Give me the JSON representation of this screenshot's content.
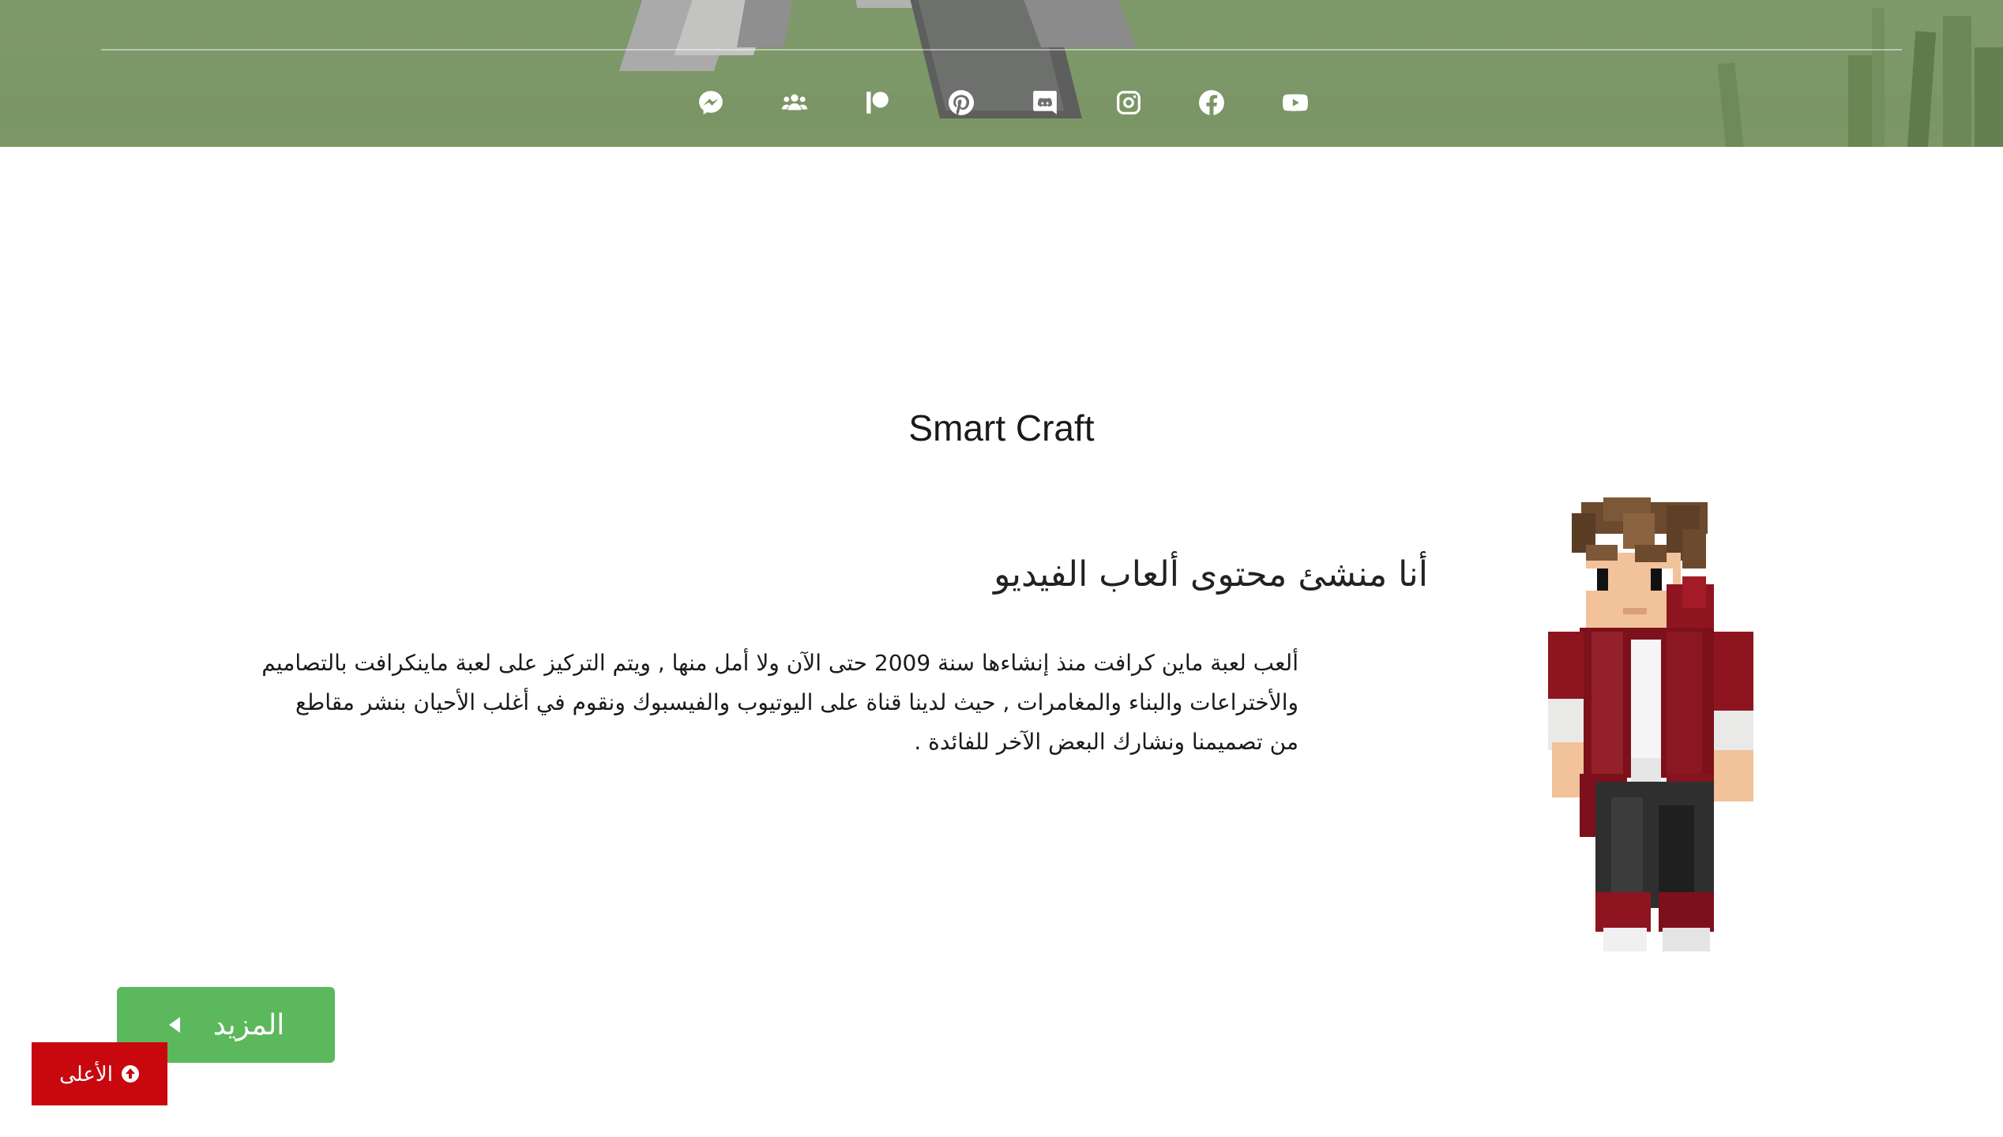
{
  "site": {
    "title": "Smart Craft"
  },
  "social": {
    "icons": [
      "messenger-icon",
      "group-icon",
      "patreon-icon",
      "pinterest-icon",
      "discord-icon",
      "instagram-icon",
      "facebook-icon",
      "youtube-icon"
    ]
  },
  "about": {
    "headline": "أنا منشئ محتوى ألعاب الفيديو",
    "lines": [
      "ألعب لعبة ماين كرافت منذ إنشاءها سنة 2009 حتى الآن ولا أمل منها , ويتم التركيز على لعبة ماينكرافت بالتصاميم",
      "والأختراعات والبناء والمغامرات , حيث لدينا قناة على اليوتيوب والفيسبوك ونقوم في أغلب الأحيان بنشر مقاطع",
      "من تصميمنا ونشارك البعض الآخر للفائدة ."
    ]
  },
  "buttons": {
    "more_label": "المزيد",
    "more_icon": "caret-left-icon",
    "top_label": "الأعلى",
    "top_icon": "arrow-up-circle-icon"
  },
  "colors": {
    "more_button": "#5cb85c",
    "top_button": "#c9070f",
    "banner": "#7f9a6a"
  }
}
